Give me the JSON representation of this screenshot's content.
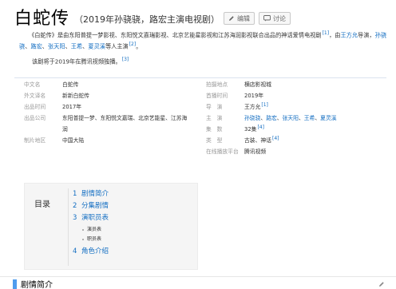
{
  "header": {
    "title": "白蛇传",
    "subtitle": "（2019年孙骁骁，路宏主演电视剧）",
    "edit_label": "编辑",
    "discuss_label": "讨论"
  },
  "summary": {
    "part1": "《白蛇传》是由东阳普提一梦影视、东阳悦文嘉瑞影视、北京艺能星影视和江苏海润影视联合出品的神话爱情电视剧",
    "ref1": "[1]",
    "part2": "，由",
    "director": "王方允",
    "part3": "导演，",
    "actor1": "孙骁骁",
    "sep1": "、",
    "actor2": "路宏",
    "sep2": "、",
    "actor3": "张天阳",
    "sep3": "、",
    "actor4": "王希",
    "sep4": "、",
    "actor5": "夏灵溪",
    "part4": "等人主演",
    "ref2": "[2]",
    "part5": "。",
    "note": "该剧将于2019年在腾讯视频独播。",
    "note_ref": "[3]"
  },
  "info": {
    "left": [
      {
        "label": "中文名",
        "value": "白蛇传"
      },
      {
        "label": "外文译名",
        "value": "新新白蛇传"
      },
      {
        "label": "出品时间",
        "value": "2017年"
      },
      {
        "label": "出品公司",
        "value": "东阳普提一梦、东阳悦文嘉瑞、北京艺能星、江苏海"
      },
      {
        "label": "",
        "value": "润"
      },
      {
        "label": "制片地区",
        "value": "中国大陆"
      }
    ],
    "right": {
      "location": {
        "label": "拍摄地点",
        "value": "横店影视城"
      },
      "premiere": {
        "label": "首播时间",
        "value": "2019年"
      },
      "director": {
        "label": "导　演",
        "value": "王方允",
        "ref": "[1]"
      },
      "cast": {
        "label": "主　演",
        "actors": [
          "孙骁骁",
          "路宏",
          "张天阳",
          "王希",
          "夏灵溪"
        ],
        "separator": "、"
      },
      "episodes": {
        "label": "集　数",
        "value": "32集",
        "ref": "[4]"
      },
      "genre": {
        "label": "类　型",
        "value": "古装、神话",
        "ref": "[4]"
      },
      "platform": {
        "label": "在线播放平台",
        "value": "腾讯视频"
      }
    }
  },
  "toc": {
    "title": "目录",
    "items": [
      {
        "num": "1",
        "label": "剧情简介"
      },
      {
        "num": "2",
        "label": "分集剧情"
      },
      {
        "num": "3",
        "label": "演职员表"
      },
      {
        "num": "4",
        "label": "角色介绍"
      }
    ],
    "subitems": [
      "演员表",
      "职员表"
    ]
  },
  "section": {
    "title": "剧情简介"
  },
  "colors": {
    "link": "#136ec2",
    "accent_bar": "#4f9cee",
    "toc_bg": "#f5f5f5"
  }
}
